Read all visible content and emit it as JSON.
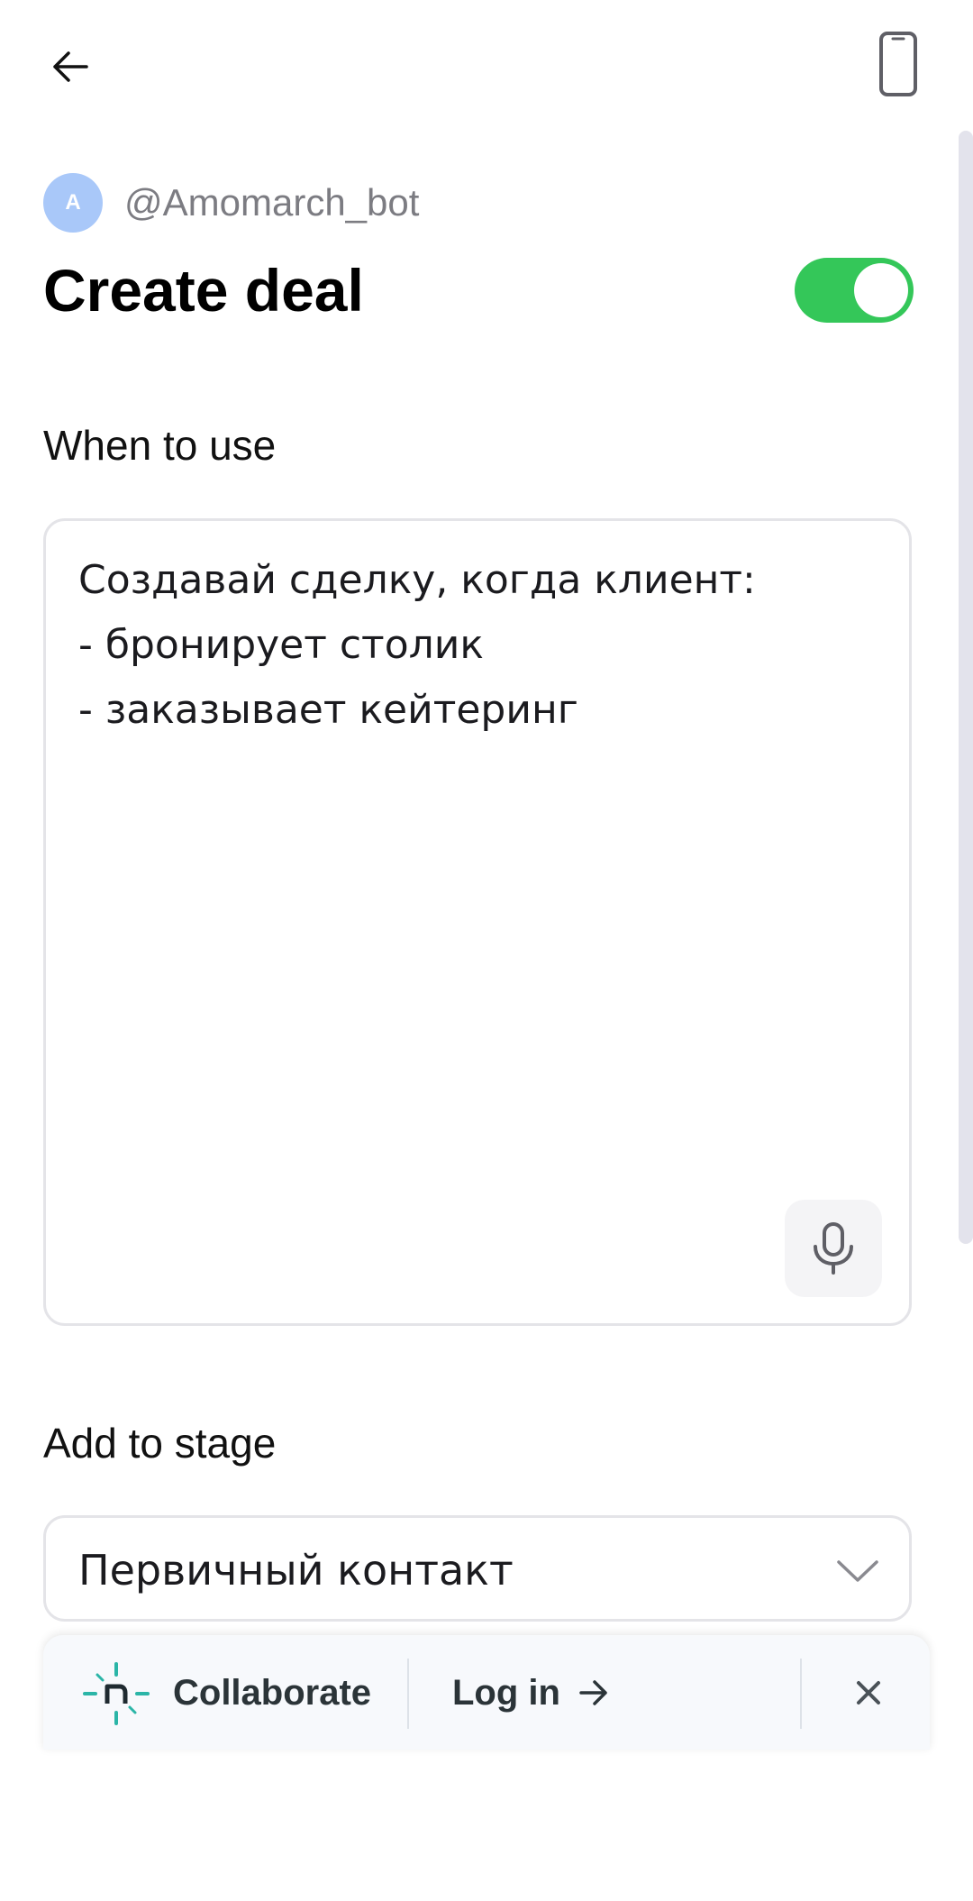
{
  "header": {
    "back_icon": "arrow-left-icon",
    "device_icon": "smartphone-icon"
  },
  "bot": {
    "avatar_letter": "A",
    "avatar_color": "#a9c8f9",
    "handle": "@Amomarch_bot"
  },
  "page": {
    "title": "Create deal",
    "enabled": true,
    "toggle_color": "#34c759"
  },
  "when_to_use": {
    "label": "When to use",
    "value": "Создавай сделку, когда клиент:\n- бронирует столик\n- заказывает кейтеринг",
    "mic_icon": "microphone-icon"
  },
  "stage": {
    "label": "Add to stage",
    "selected": "Первичный контакт",
    "chevron_icon": "chevron-down-icon"
  },
  "banner": {
    "logo_icon": "netlify-logo-icon",
    "logo_color": "#2bb5a7",
    "collaborate_label": "Collaborate",
    "login_label": "Log in",
    "login_arrow_icon": "arrow-right-icon",
    "close_icon": "close-icon"
  }
}
